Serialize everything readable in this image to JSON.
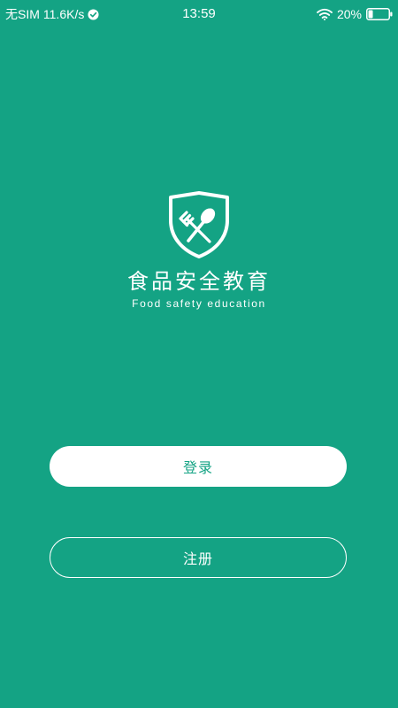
{
  "status_bar": {
    "carrier": "无SIM",
    "speed": "11.6K/s",
    "time": "13:59",
    "battery": "20%"
  },
  "logo": {
    "icon": "shield-fork-spoon-icon",
    "title": "食品安全教育",
    "subtitle": "Food safety education"
  },
  "buttons": {
    "login": "登录",
    "register": "注册"
  },
  "colors": {
    "background": "#14a384",
    "foreground": "#ffffff"
  }
}
